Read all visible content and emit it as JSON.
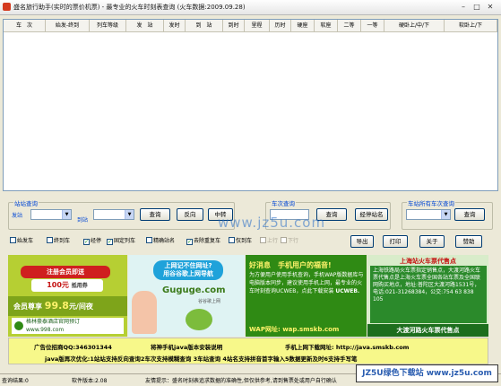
{
  "window": {
    "title": "盛名旅行助手(实时的票价机票) - 最专业的火车时刻表查询 (火车数据:2009.09.28)"
  },
  "grid": {
    "columns": [
      "车　次",
      "始发-终到",
      "列车等级",
      "发　站",
      "发时",
      "到　站",
      "到时",
      "里程",
      "历时",
      "硬座",
      "软座",
      "二等",
      "一等",
      "硬卧上/中/下",
      "软卧上/下"
    ]
  },
  "station_query": {
    "label": "站站查询",
    "from_label": "发站",
    "to_label": "到站",
    "from_value": "",
    "to_value": "",
    "query_btn": "查询",
    "reverse_btn": "反向",
    "transfer_btn": "中转"
  },
  "train_query": {
    "label": "车次查询",
    "input_value": "",
    "query_btn": "查询",
    "passby_btn": "经停站名"
  },
  "station_all": {
    "label": "车站所有车次查询",
    "value": "",
    "query_btn": "查询"
  },
  "filters": [
    {
      "label": "始发车",
      "checked": false,
      "enabled": true
    },
    {
      "label": "终到车",
      "checked": false,
      "enabled": true
    },
    {
      "label": "经停",
      "checked": true,
      "enabled": true
    },
    {
      "label": "固定列车",
      "checked": true,
      "enabled": true
    },
    {
      "label": "精确站名",
      "checked": false,
      "enabled": true
    },
    {
      "label": "去除重复车",
      "checked": true,
      "enabled": true
    },
    {
      "label": "仅到车",
      "checked": false,
      "enabled": true
    },
    {
      "label": "上行",
      "checked": false,
      "enabled": false
    },
    {
      "label": "下行",
      "checked": false,
      "enabled": false
    }
  ],
  "actions": {
    "export": "导出",
    "print": "打印",
    "about": "关于",
    "donate": "赞助"
  },
  "ads": {
    "ad1": {
      "ribbon": "注册会员即送",
      "price_band": "100元",
      "price_suffix": "抵用券",
      "member_prefix": "会员尊享",
      "member_price": "99.8",
      "member_suffix": "元/间夜",
      "hotel_line1": "格林豪泰酒店官网预订",
      "hotel_line2": "www.998.com"
    },
    "ad2": {
      "bubble_line1": "上网记不住网址?",
      "bubble_line2": "用谷谷歌上网导航",
      "brand": "Guguge.com",
      "sub": "谷谷歌上网"
    },
    "ad3": {
      "head": "好消息　手机用户的福音!",
      "body": "为方便用户使用手机查询，手机WAP版数据库与电脑版本同步，建议使用手机上网，最专业的火车时刻查询UCWEB，点此下载安装",
      "ucweb": "UCWEB.",
      "foot": "WAP网址: wap.smskb.com"
    },
    "ad4": {
      "head": "上海站火车票代售点",
      "body": "上海铁路局火车票指定销售点，大渡河路火车票代售点是上海火车票全国各站车票及全国联网购买地点，地址:普陀区大渡河路1531号，电话:021-31268384，公交:754 63 838 105",
      "foot": "大渡河路火车票代售点"
    }
  },
  "info": {
    "line1_a": "广告位招商QQ:346301344",
    "line1_b": "将神手机java版本安装说明",
    "line1_c": "手机上网下载网址: http://java.smskb.com",
    "line2": "java版再次优化:1站站支持反向查询2车次支持模糊查询 3车站查询 4站名支持拼音首字输入5数据更新及时6支持手写笔"
  },
  "status": {
    "result_label": "查询结果:0",
    "version_label": "软件版本:2.08",
    "tip": "友情提示：盛名时刻表追求数据的准确性,但仅供参考,请到售票处或用户自行确认"
  },
  "watermark": {
    "text": "JZ5U绿色下载站 www.jz5u.com",
    "overlay": "www.jz5u.com"
  }
}
